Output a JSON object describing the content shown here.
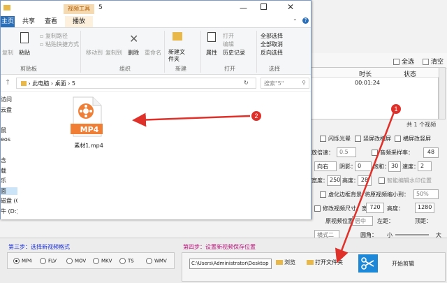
{
  "background_app": {
    "select_all": "全选",
    "clear": "清空",
    "columns": {
      "duration": "时长",
      "status": "状态"
    },
    "row": {
      "duration": "00:01:24"
    },
    "count_text": "共 1 个视频",
    "options": {
      "flash": "闪烁光晕",
      "landscape_to_portrait": "竖屏改横屏",
      "portrait_to_landscape": "横屏改竖屏",
      "speed_label": "放倍速：",
      "speed_val": "0.5",
      "audio_rate": "音频采样率：",
      "audio_val": "48",
      "rotate": "向右",
      "shadow_label": "阴影：",
      "shadow_val": "0",
      "saturation_label": "饱和：",
      "saturation_val": "30",
      "speed2_label": "速度：",
      "speed2_val": "2",
      "width_label": "宽度：",
      "width_val": "250",
      "height_label": "高度：",
      "height_val": "28",
      "smart_edit": "智能编辑水印位置",
      "blur_border": "虚化边框背景",
      "ratio_label": "将原视频缩小到：",
      "ratio_val": "50%",
      "modify_size": "修改视频尺寸，宽度：",
      "size_w": "720",
      "size_h_label": "高度：",
      "size_h": "1280",
      "orig_pos_label": "原视频位置：",
      "orig_pos_val": "居中",
      "left_label": "左距：",
      "top_label": "顶距：",
      "mode_label": "横式二",
      "rounded_label": "圆角：",
      "small": "小",
      "large": "大"
    },
    "step3": {
      "title": "第三步：选择新视频格式",
      "formats": [
        "MP4",
        "FLV",
        "MOV",
        "MKV",
        "TS",
        "WMV"
      ],
      "selected": "MP4"
    },
    "step4": {
      "title": "第四步：设置新视频保存位置",
      "path": "C:\\Users\\Administrator\\Desktop",
      "browse": "浏览",
      "open_folder": "打开文件夹",
      "start": "开始剪辑"
    }
  },
  "explorer": {
    "context_tab": "视频工具",
    "window_title": "5",
    "tabs": [
      "主页",
      "共享",
      "查看",
      "播放"
    ],
    "ribbon": {
      "clipboard": {
        "copy": "复制",
        "paste": "粘贴",
        "copy_path": "复制路径",
        "paste_shortcut": "粘贴快捷方式",
        "label": "剪贴板"
      },
      "organize": {
        "move_to": "移动到",
        "copy_to": "复制到",
        "delete": "删除",
        "rename": "重命名",
        "label": "组织"
      },
      "new": {
        "new_folder": "新建文件夹",
        "label": "新建"
      },
      "open": {
        "properties": "属性",
        "open": "打开",
        "edit": "编辑",
        "history": "历史记录",
        "label": "打开"
      },
      "select": {
        "select_all": "全部选择",
        "select_none": "全部取消",
        "invert": "反向选择",
        "label": "选择"
      }
    },
    "address": {
      "crumbs": [
        "此电脑",
        "桌面",
        "5"
      ],
      "search_placeholder": "搜索\"5\""
    },
    "nav_items": [
      "访问",
      "云盘",
      "",
      "鼠",
      "eos",
      "",
      "含",
      "载",
      "乐",
      "面",
      "磁盘 (C:)",
      "牛 (D:)"
    ],
    "file": {
      "name": "素材1.mp4",
      "badge": "MP4"
    }
  },
  "annotations": {
    "one": "1",
    "two": "2"
  },
  "colors": {
    "arrow": "#e0302a",
    "step_title": "#1a2fd6",
    "step4_title": "#b8137a",
    "mp4_orange": "#f07e34"
  }
}
